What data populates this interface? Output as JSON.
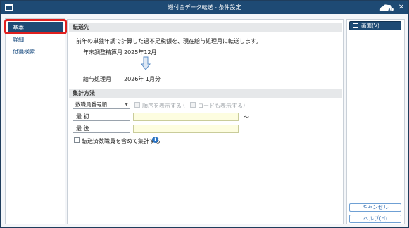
{
  "window": {
    "title": "遡付金データ転送 - 条件設定",
    "close_glyph": "✕",
    "colors": {
      "titlebar": "#1e4a74",
      "accent": "#1e4a74",
      "highlight": "#e0201f",
      "input_bg": "#fdfde0",
      "info": "#2a74c4"
    }
  },
  "sidebar": {
    "items": [
      {
        "label": "基本",
        "active": true
      },
      {
        "label": "詳細",
        "active": false
      },
      {
        "label": "付箋検索",
        "active": false
      }
    ]
  },
  "transfer": {
    "header": "転送先",
    "description": "前年の単独年調で計算した過不足税額を、現在給与処理月に転送します。",
    "source_label": "年末調整精算月",
    "source_value": "2025年12月",
    "arrow_icon": "down-arrow-icon",
    "dest_label": "給与処理月",
    "dest_value": "2026年 1月分"
  },
  "aggregation": {
    "header": "集計方法",
    "order_select": "数職員番号順",
    "show_order_label": "順序を表示する",
    "paren_open": "(",
    "show_code_label": "コードも表示する",
    "paren_close": ")",
    "first_label": "最 初",
    "last_label": "最 後",
    "tilde": "〜",
    "include_transferred_label": "転送済数職員を含めて集計する",
    "info_glyph": "i"
  },
  "actions": {
    "screen_button": "画面(V)",
    "cancel_button": "キャンセル",
    "help_button": "ヘルプ(H)"
  }
}
